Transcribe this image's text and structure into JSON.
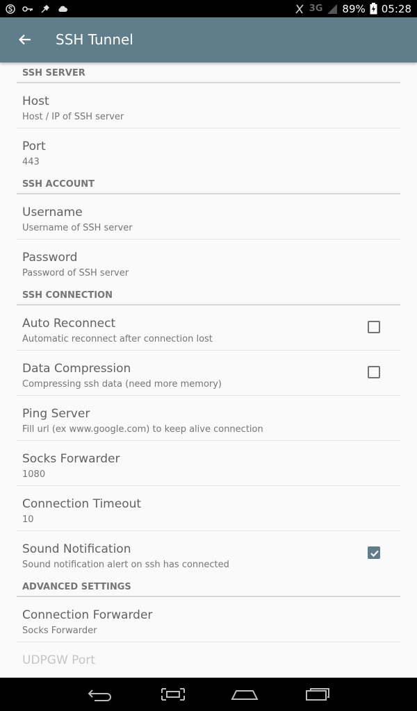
{
  "status_bar": {
    "icons_left": [
      "shield-s-icon",
      "key-icon",
      "satellite-icon",
      "cloud-icon"
    ],
    "network": "3G",
    "battery": "89%",
    "time": "05:28"
  },
  "app_bar": {
    "title": "SSH Tunnel",
    "back_icon": "arrow-back-icon",
    "color": "#607d8b"
  },
  "sections": {
    "ssh_server": {
      "header": "SSH SERVER",
      "host": {
        "title": "Host",
        "summary": "Host / IP of SSH server"
      },
      "port": {
        "title": "Port",
        "summary": "443"
      }
    },
    "ssh_account": {
      "header": "SSH ACCOUNT",
      "username": {
        "title": "Username",
        "summary": "Username of SSH server"
      },
      "password": {
        "title": "Password",
        "summary": "Password of SSH server"
      }
    },
    "ssh_connection": {
      "header": "SSH CONNECTION",
      "auto_reconnect": {
        "title": "Auto Reconnect",
        "summary": "Automatic reconnect after connection lost",
        "checked": false
      },
      "data_compression": {
        "title": "Data Compression",
        "summary": "Compressing ssh data (need more memory)",
        "checked": false
      },
      "ping_server": {
        "title": "Ping Server",
        "summary": "Fill url (ex www.google.com) to keep alive connection"
      },
      "socks_forwarder": {
        "title": "Socks Forwarder",
        "summary": "1080"
      },
      "connection_timeout": {
        "title": "Connection Timeout",
        "summary": "10"
      },
      "sound_notification": {
        "title": "Sound Notification",
        "summary": "Sound notification alert on ssh has connected",
        "checked": true
      }
    },
    "advanced": {
      "header": "ADVANCED SETTINGS",
      "connection_forwarder": {
        "title": "Connection Forwarder",
        "summary": "Socks Forwarder"
      },
      "udpgw_port": {
        "title": "UDPGW Port",
        "enabled": false
      }
    }
  },
  "nav_bar": {
    "buttons": [
      "back-icon",
      "screenshot-icon",
      "home-icon",
      "recents-icon"
    ]
  }
}
